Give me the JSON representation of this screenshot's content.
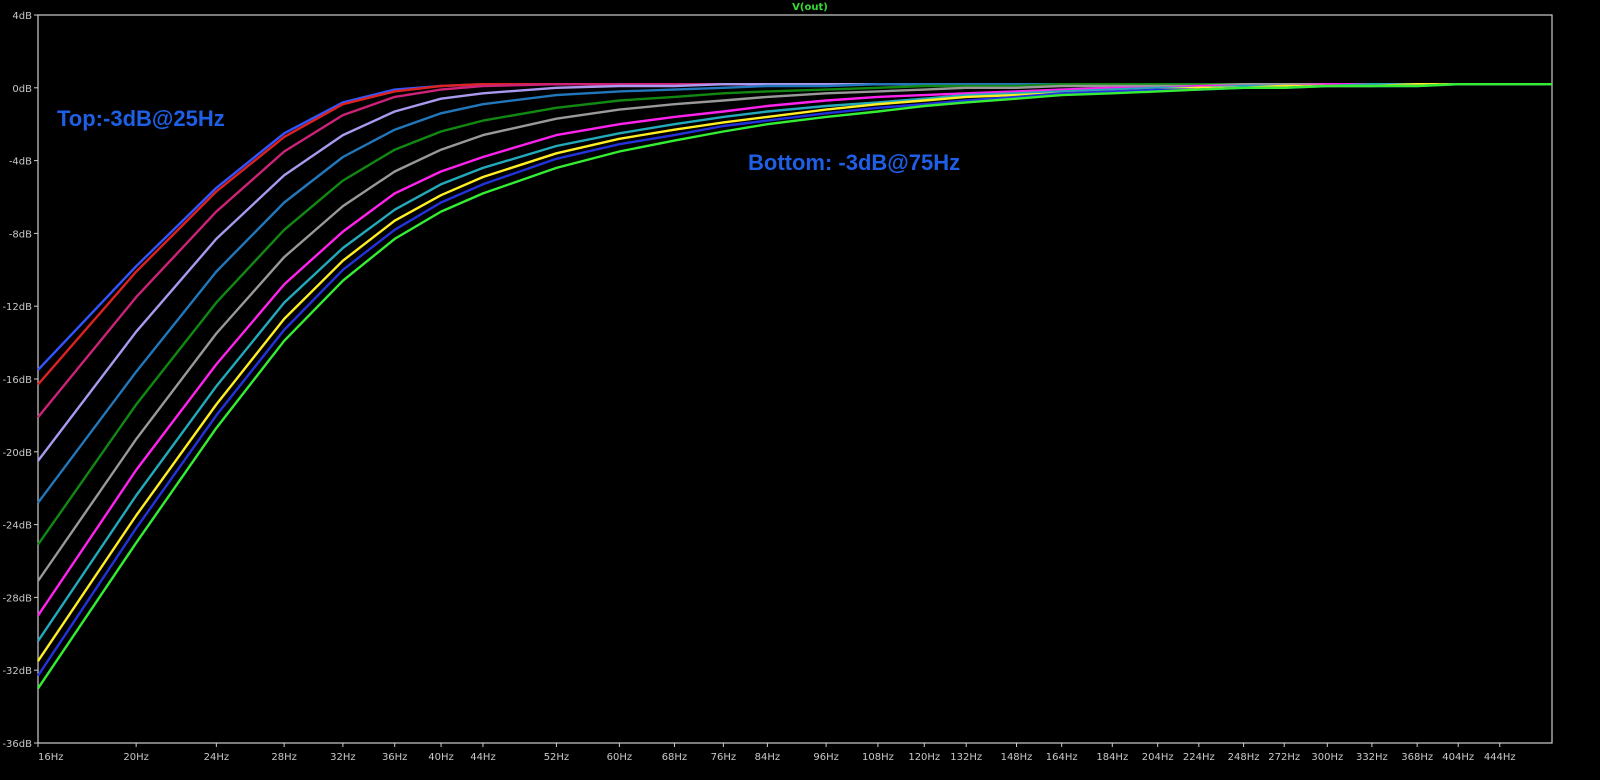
{
  "chart_data": {
    "type": "line",
    "title": "V(out)",
    "xlabel": "",
    "ylabel": "",
    "x_scale": "log",
    "xlim": [
      16,
      500
    ],
    "ylim": [
      -36,
      4
    ],
    "grid": false,
    "y_ticks": [
      {
        "value": 4,
        "label": "4dB"
      },
      {
        "value": 0,
        "label": "0dB"
      },
      {
        "value": -4,
        "label": "-4dB"
      },
      {
        "value": -8,
        "label": "-8dB"
      },
      {
        "value": -12,
        "label": "-12dB"
      },
      {
        "value": -16,
        "label": "-16dB"
      },
      {
        "value": -20,
        "label": "-20dB"
      },
      {
        "value": -24,
        "label": "-24dB"
      },
      {
        "value": -28,
        "label": "-28dB"
      },
      {
        "value": -32,
        "label": "-32dB"
      },
      {
        "value": -36,
        "label": "-36dB"
      }
    ],
    "x_ticks": [
      {
        "value": 16,
        "label": "16Hz"
      },
      {
        "value": 20,
        "label": "20Hz"
      },
      {
        "value": 24,
        "label": "24Hz"
      },
      {
        "value": 28,
        "label": "28Hz"
      },
      {
        "value": 32,
        "label": "32Hz"
      },
      {
        "value": 36,
        "label": "36Hz"
      },
      {
        "value": 40,
        "label": "40Hz"
      },
      {
        "value": 44,
        "label": "44Hz"
      },
      {
        "value": 52,
        "label": "52Hz"
      },
      {
        "value": 60,
        "label": "60Hz"
      },
      {
        "value": 68,
        "label": "68Hz"
      },
      {
        "value": 76,
        "label": "76Hz"
      },
      {
        "value": 84,
        "label": "84Hz"
      },
      {
        "value": 96,
        "label": "96Hz"
      },
      {
        "value": 108,
        "label": "108Hz"
      },
      {
        "value": 120,
        "label": "120Hz"
      },
      {
        "value": 132,
        "label": "132Hz"
      },
      {
        "value": 148,
        "label": "148Hz"
      },
      {
        "value": 164,
        "label": "164Hz"
      },
      {
        "value": 184,
        "label": "184Hz"
      },
      {
        "value": 204,
        "label": "204Hz"
      },
      {
        "value": 224,
        "label": "224Hz"
      },
      {
        "value": 248,
        "label": "248Hz"
      },
      {
        "value": 272,
        "label": "272Hz"
      },
      {
        "value": 300,
        "label": "300Hz"
      },
      {
        "value": 332,
        "label": "332Hz"
      },
      {
        "value": 368,
        "label": "368Hz"
      },
      {
        "value": 404,
        "label": "404Hz"
      },
      {
        "value": 444,
        "label": "444Hz"
      }
    ],
    "x": [
      16,
      20,
      24,
      28,
      32,
      36,
      40,
      44,
      52,
      60,
      68,
      76,
      84,
      96,
      108,
      120,
      132,
      148,
      164,
      184,
      204,
      224,
      248,
      272,
      300,
      332,
      368,
      404,
      444,
      500
    ],
    "series": [
      {
        "color": "#3355ff",
        "values": [
          -15.5,
          -9.8,
          -5.5,
          -2.5,
          -0.8,
          -0.1,
          0.1,
          0.2,
          0.2,
          0.2,
          0.2,
          0.2,
          0.2,
          0.2,
          0.2,
          0.2,
          0.2,
          0.2,
          0.2,
          0.2,
          0.2,
          0.2,
          0.2,
          0.2,
          0.2,
          0.2,
          0.2,
          0.2,
          0.2,
          0.2
        ]
      },
      {
        "color": "#dd2222",
        "values": [
          -16.3,
          -10.1,
          -5.7,
          -2.7,
          -0.9,
          -0.2,
          0.1,
          0.2,
          0.2,
          0.2,
          0.2,
          0.2,
          0.2,
          0.2,
          0.2,
          0.2,
          0.2,
          0.2,
          0.2,
          0.2,
          0.2,
          0.2,
          0.2,
          0.2,
          0.2,
          0.2,
          0.2,
          0.2,
          0.2,
          0.2
        ]
      },
      {
        "color": "#cc2277",
        "values": [
          -18.1,
          -11.5,
          -6.8,
          -3.5,
          -1.5,
          -0.5,
          -0.1,
          0.1,
          0.2,
          0.2,
          0.2,
          0.2,
          0.2,
          0.2,
          0.2,
          0.2,
          0.2,
          0.2,
          0.2,
          0.2,
          0.2,
          0.2,
          0.2,
          0.2,
          0.2,
          0.2,
          0.2,
          0.2,
          0.2,
          0.2
        ]
      },
      {
        "color": "#aa99ee",
        "values": [
          -20.5,
          -13.4,
          -8.3,
          -4.8,
          -2.6,
          -1.3,
          -0.6,
          -0.3,
          0.0,
          0.1,
          0.1,
          0.2,
          0.2,
          0.2,
          0.2,
          0.2,
          0.2,
          0.2,
          0.2,
          0.2,
          0.2,
          0.2,
          0.2,
          0.2,
          0.2,
          0.2,
          0.2,
          0.2,
          0.2,
          0.2
        ]
      },
      {
        "color": "#2277bb",
        "values": [
          -22.8,
          -15.6,
          -10.1,
          -6.3,
          -3.8,
          -2.3,
          -1.4,
          -0.9,
          -0.4,
          -0.2,
          -0.1,
          0.0,
          0.1,
          0.1,
          0.2,
          0.2,
          0.2,
          0.2,
          0.2,
          0.2,
          0.2,
          0.2,
          0.2,
          0.2,
          0.2,
          0.2,
          0.2,
          0.2,
          0.2,
          0.2
        ]
      },
      {
        "color": "#118811",
        "values": [
          -25.1,
          -17.4,
          -11.8,
          -7.8,
          -5.1,
          -3.4,
          -2.4,
          -1.8,
          -1.1,
          -0.7,
          -0.5,
          -0.3,
          -0.2,
          -0.1,
          0.0,
          0.1,
          0.1,
          0.1,
          0.2,
          0.2,
          0.2,
          0.2,
          0.2,
          0.2,
          0.2,
          0.2,
          0.2,
          0.2,
          0.2,
          0.2
        ]
      },
      {
        "color": "#999999",
        "values": [
          -27.1,
          -19.3,
          -13.5,
          -9.3,
          -6.5,
          -4.6,
          -3.4,
          -2.6,
          -1.7,
          -1.2,
          -0.9,
          -0.7,
          -0.5,
          -0.3,
          -0.2,
          -0.1,
          0.0,
          0.0,
          0.1,
          0.1,
          0.1,
          0.1,
          0.2,
          0.2,
          0.2,
          0.2,
          0.2,
          0.2,
          0.2,
          0.2
        ]
      },
      {
        "color": "#ff22ee",
        "values": [
          -29.0,
          -21.0,
          -15.2,
          -10.8,
          -7.9,
          -5.8,
          -4.6,
          -3.8,
          -2.6,
          -2.0,
          -1.6,
          -1.3,
          -1.0,
          -0.7,
          -0.5,
          -0.4,
          -0.3,
          -0.2,
          -0.1,
          0.0,
          0.0,
          0.1,
          0.1,
          0.1,
          0.2,
          0.2,
          0.2,
          0.2,
          0.2,
          0.2
        ]
      },
      {
        "color": "#22aabb",
        "values": [
          -30.4,
          -22.4,
          -16.4,
          -11.8,
          -8.8,
          -6.7,
          -5.3,
          -4.4,
          -3.2,
          -2.5,
          -2.0,
          -1.6,
          -1.3,
          -1.0,
          -0.8,
          -0.6,
          -0.4,
          -0.3,
          -0.2,
          -0.1,
          0.0,
          0.0,
          0.1,
          0.1,
          0.1,
          0.2,
          0.2,
          0.2,
          0.2,
          0.2
        ]
      },
      {
        "color": "#ffee22",
        "values": [
          -31.5,
          -23.5,
          -17.4,
          -12.7,
          -9.5,
          -7.3,
          -5.9,
          -4.9,
          -3.6,
          -2.8,
          -2.3,
          -1.9,
          -1.6,
          -1.2,
          -0.9,
          -0.7,
          -0.5,
          -0.4,
          -0.3,
          -0.2,
          -0.1,
          0.0,
          0.0,
          0.1,
          0.1,
          0.1,
          0.2,
          0.2,
          0.2,
          0.2
        ]
      },
      {
        "color": "#2233dd",
        "values": [
          -32.3,
          -24.2,
          -18.0,
          -13.3,
          -10.0,
          -7.8,
          -6.3,
          -5.3,
          -3.9,
          -3.1,
          -2.6,
          -2.1,
          -1.8,
          -1.4,
          -1.1,
          -0.9,
          -0.7,
          -0.5,
          -0.3,
          -0.2,
          -0.1,
          -0.1,
          0.0,
          0.0,
          0.1,
          0.1,
          0.1,
          0.2,
          0.2,
          0.2
        ]
      },
      {
        "color": "#33ee33",
        "values": [
          -33.0,
          -25.0,
          -18.7,
          -13.9,
          -10.6,
          -8.3,
          -6.8,
          -5.8,
          -4.4,
          -3.5,
          -2.9,
          -2.4,
          -2.0,
          -1.6,
          -1.3,
          -1.0,
          -0.8,
          -0.6,
          -0.4,
          -0.3,
          -0.2,
          -0.1,
          0.0,
          0.0,
          0.1,
          0.1,
          0.1,
          0.2,
          0.2,
          0.2
        ]
      }
    ],
    "annotations": [
      {
        "text": "Top:-3dB@25Hz"
      },
      {
        "text": "Bottom: -3dB@75Hz"
      }
    ]
  }
}
